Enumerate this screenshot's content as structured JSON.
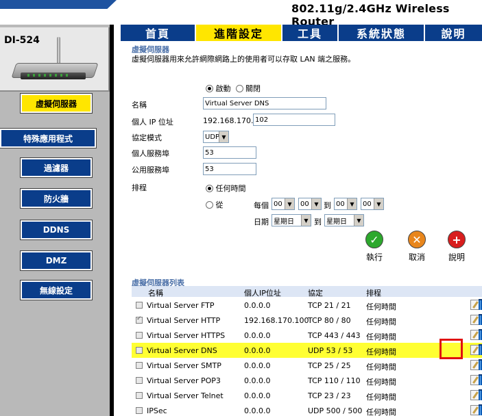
{
  "header": {
    "title": "802.11g/2.4GHz Wireless Router",
    "colors": {
      "brand_blue": "#0a3d8a",
      "active_yellow": "#ffe600",
      "highlight": "#ffff33",
      "marker_red": "#e01010"
    }
  },
  "device": {
    "model": "DI-524"
  },
  "tabs": [
    {
      "label": "首頁",
      "active": false
    },
    {
      "label": "進階設定",
      "active": true
    },
    {
      "label": "工具",
      "active": false
    },
    {
      "label": "系統狀態",
      "active": false
    },
    {
      "label": "說明",
      "active": false
    }
  ],
  "sidebar": {
    "items": [
      {
        "label": "虛擬伺服器",
        "active": true
      },
      {
        "label": "特殊應用程式",
        "active": false
      },
      {
        "label": "過濾器",
        "active": false
      },
      {
        "label": "防火牆",
        "active": false
      },
      {
        "label": "DDNS",
        "active": false
      },
      {
        "label": "DMZ",
        "active": false
      },
      {
        "label": "無線設定",
        "active": false
      }
    ]
  },
  "form": {
    "section_title": "虛擬伺服器",
    "description": "虛擬伺服器用來允許網際網路上的使用者可以存取 LAN 端之服務。",
    "enable_label": "啟動",
    "disable_label": "關閉",
    "name_label": "名稱",
    "name_value": "Virtual Server DNS",
    "ip_label": "個人 IP 位址",
    "ip_prefix": "192.168.170.",
    "ip_value": "102",
    "protocol_label": "協定模式",
    "protocol_value": "UDP",
    "private_port_label": "個人服務埠",
    "private_port_value": "53",
    "public_port_label": "公用服務埠",
    "public_port_value": "53",
    "schedule_label": "排程",
    "always_label": "任何時間",
    "from_label": "從",
    "every_label": "每個",
    "to_label": "到",
    "time_from_h": "00",
    "time_from_m": "00",
    "time_to_h": "00",
    "time_to_m": "00",
    "day_label": "日期",
    "day_from": "星期日",
    "day_to": "星期日"
  },
  "actions": {
    "apply": "執行",
    "cancel": "取消",
    "help": "說明"
  },
  "list": {
    "title": "虛擬伺服器列表",
    "headers": {
      "name": "名稱",
      "ip": "個人IP位址",
      "protocol": "協定",
      "schedule": "排程"
    },
    "rows": [
      {
        "name": "Virtual Server FTP",
        "ip": "0.0.0.0",
        "protocol": "TCP 21 / 21",
        "schedule": "任何時間",
        "checked": false
      },
      {
        "name": "Virtual Server HTTP",
        "ip": "192.168.170.100",
        "protocol": "TCP 80 / 80",
        "schedule": "任何時間",
        "checked": true
      },
      {
        "name": "Virtual Server HTTPS",
        "ip": "0.0.0.0",
        "protocol": "TCP 443 / 443",
        "schedule": "任何時間",
        "checked": false
      },
      {
        "name": "Virtual Server DNS",
        "ip": "0.0.0.0",
        "protocol": "UDP 53 / 53",
        "schedule": "任何時間",
        "checked": false,
        "highlighted": true
      },
      {
        "name": "Virtual Server SMTP",
        "ip": "0.0.0.0",
        "protocol": "TCP 25 / 25",
        "schedule": "任何時間",
        "checked": false
      },
      {
        "name": "Virtual Server POP3",
        "ip": "0.0.0.0",
        "protocol": "TCP 110 / 110",
        "schedule": "任何時間",
        "checked": false
      },
      {
        "name": "Virtual Server Telnet",
        "ip": "0.0.0.0",
        "protocol": "TCP 23 / 23",
        "schedule": "任何時間",
        "checked": false
      },
      {
        "name": "IPSec",
        "ip": "0.0.0.0",
        "protocol": "UDP 500 / 500",
        "schedule": "任何時間",
        "checked": false
      }
    ]
  }
}
